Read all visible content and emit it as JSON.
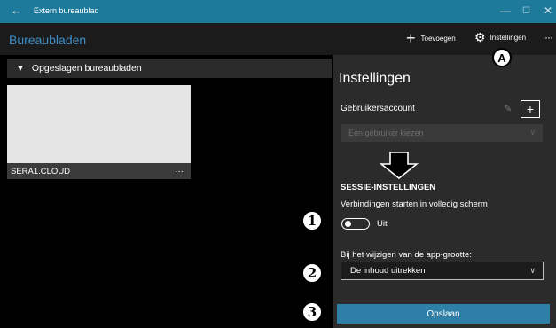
{
  "titlebar": {
    "back_glyph": "←",
    "title": "Extern bureaublad",
    "min_glyph": "—",
    "max_glyph": "☐",
    "close_glyph": "✕"
  },
  "appbar": {
    "page_title": "Bureaubladen",
    "add_label": "Toevoegen",
    "settings_label": "Instellingen",
    "more_glyph": "···"
  },
  "group": {
    "label": "Opgeslagen bureaubladen"
  },
  "tile": {
    "name": "SERA1.CLOUD",
    "more_glyph": "···"
  },
  "settings_pane": {
    "heading": "Instellingen",
    "account_label": "Gebruikersaccount",
    "account_placeholder": "Een gebruiker kiezen",
    "section_title": "SESSIE-INSTELLINGEN",
    "fullscreen_label": "Verbindingen starten in volledig scherm",
    "fullscreen_state": "Uit",
    "fullscreen_on": false,
    "resize_label": "Bij het wijzigen van de app-grootte:",
    "resize_value": "De inhoud uitrekken",
    "save_label": "Opslaan"
  },
  "callouts": {
    "a": "A",
    "one": "1",
    "two": "2",
    "three": "3"
  },
  "colors": {
    "titlebar": "#1e7a9b",
    "accent_text": "#3c8fc9",
    "save_button": "#2d7fa8",
    "pane_bg": "#2b2b2b"
  },
  "icons": {
    "back": "back-arrow-icon",
    "add": "plus-icon",
    "settings": "gear-icon",
    "edit": "pencil-icon",
    "chevron": "chevron-down-icon"
  }
}
